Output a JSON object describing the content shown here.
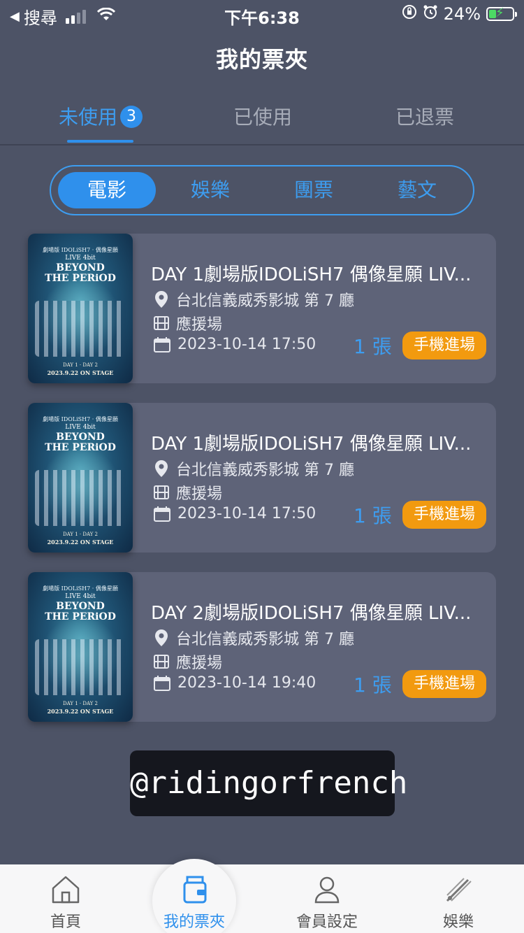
{
  "status_bar": {
    "back_app": "搜尋",
    "time": "下午6:38",
    "battery": "24%"
  },
  "header": {
    "title": "我的票夾"
  },
  "tabs": [
    {
      "label": "未使用",
      "badge": "3",
      "active": true
    },
    {
      "label": "已使用",
      "active": false
    },
    {
      "label": "已退票",
      "active": false
    }
  ],
  "segments": [
    {
      "label": "電影",
      "active": true
    },
    {
      "label": "娛樂",
      "active": false
    },
    {
      "label": "團票",
      "active": false
    },
    {
      "label": "藝文",
      "active": false
    }
  ],
  "poster": {
    "top_text": "劇場版 IDOLiSH7 · 偶像星願",
    "live_text": "LIVE 4bit",
    "title_line1": "BEYOND",
    "title_line2": "THE PERiOD",
    "days_text": "DAY 1 · DAY 2",
    "onstage_text": "2023.9.22 ON STAGE"
  },
  "tickets": [
    {
      "title": "DAY 1劇場版IDOLiSH7 偶像星願 LIV...",
      "location": "台北信義威秀影城 第 7 廳",
      "type": "應援場",
      "datetime": "2023-10-14 17:50",
      "quantity": "1 張",
      "action": "手機進場"
    },
    {
      "title": "DAY 1劇場版IDOLiSH7 偶像星願 LIV...",
      "location": "台北信義威秀影城 第 7 廳",
      "type": "應援場",
      "datetime": "2023-10-14 17:50",
      "quantity": "1 張",
      "action": "手機進場"
    },
    {
      "title": "DAY 2劇場版IDOLiSH7 偶像星願 LIV...",
      "location": "台北信義威秀影城 第 7 廳",
      "type": "應援場",
      "datetime": "2023-10-14 19:40",
      "quantity": "1 張",
      "action": "手機進場"
    }
  ],
  "watermark": "@ridingorfrench",
  "bottom_nav": [
    {
      "label": "首頁",
      "icon": "home-icon",
      "active": false
    },
    {
      "label": "我的票夾",
      "icon": "wallet-icon",
      "active": true
    },
    {
      "label": "會員設定",
      "icon": "user-icon",
      "active": false
    },
    {
      "label": "娛樂",
      "icon": "entertainment-icon",
      "active": false
    }
  ],
  "colors": {
    "background": "#4d5366",
    "card": "#5e6378",
    "accent": "#2f90ec",
    "action": "#f29a0f"
  }
}
